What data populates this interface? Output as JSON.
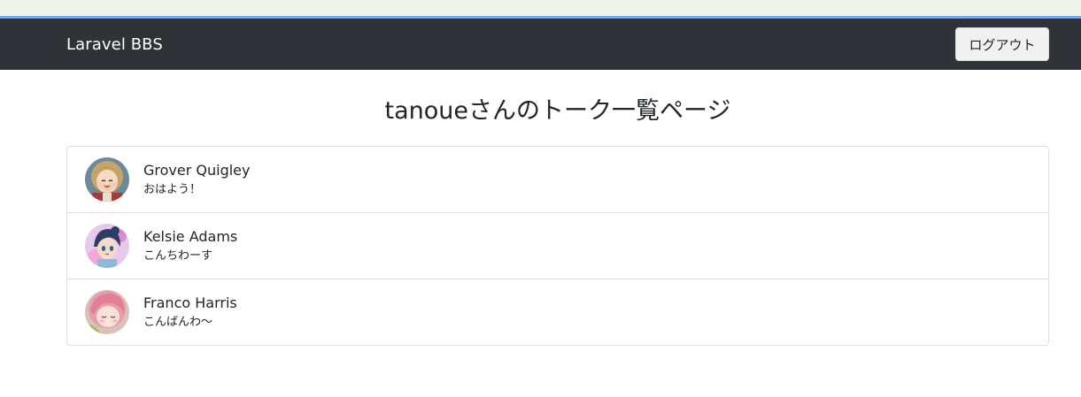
{
  "navbar": {
    "brand": "Laravel BBS",
    "logout_label": "ログアウト"
  },
  "main": {
    "title": "tanoueさんのトーク一覧ページ"
  },
  "talks": [
    {
      "name": "Grover Quigley",
      "message": "おはよう！"
    },
    {
      "name": "Kelsie Adams",
      "message": "こんちわーす"
    },
    {
      "name": "Franco Harris",
      "message": "こんばんわ〜"
    }
  ],
  "colors": {
    "navbar_bg": "#2f3338",
    "accent_line": "#7aa7e6",
    "top_strip": "#eef4ea",
    "border": "#dfdfdf"
  }
}
